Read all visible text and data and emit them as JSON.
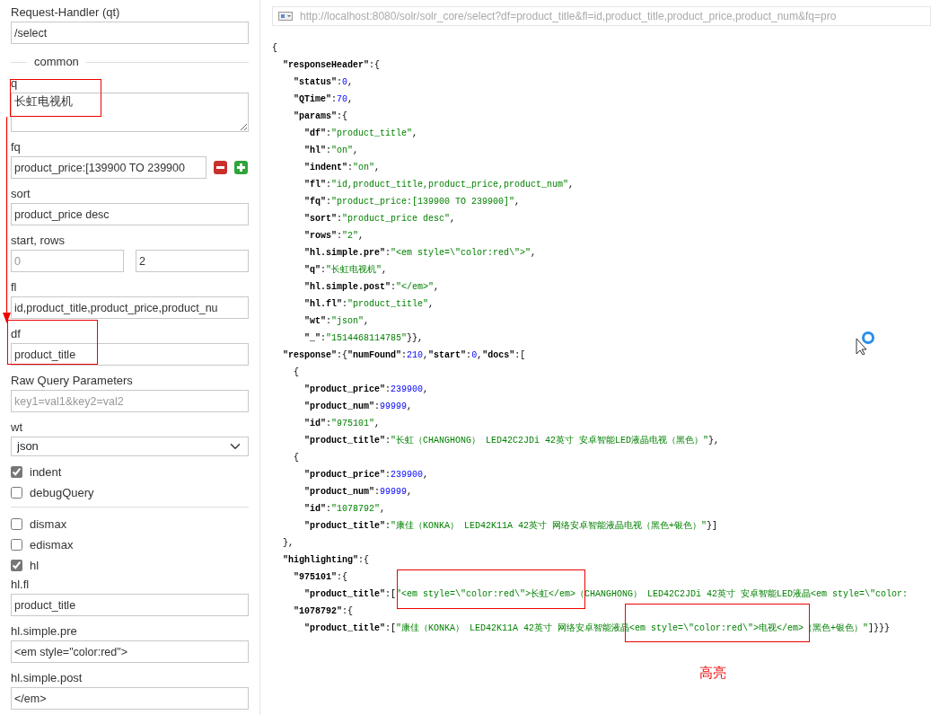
{
  "form": {
    "fields": [
      {
        "kind": "text",
        "label": "Request-Handler (qt)",
        "value": "/select"
      },
      {
        "kind": "legend",
        "label": "common"
      },
      {
        "kind": "textarea",
        "label": "q",
        "value": "长虹电视机"
      },
      {
        "kind": "filter",
        "label": "fq",
        "value": "product_price:[139900 TO 239900"
      },
      {
        "kind": "text",
        "label": "sort",
        "value": "product_price desc"
      },
      {
        "kind": "pair",
        "label": "start, rows",
        "inputs": [
          {
            "placeholder": "0"
          },
          {
            "value": "2"
          }
        ]
      },
      {
        "kind": "text",
        "label": "fl",
        "value": "id,product_title,product_price,product_nu"
      },
      {
        "kind": "text",
        "label": "df",
        "value": "product_title"
      },
      {
        "kind": "text",
        "label": "Raw Query Parameters",
        "placeholder": "key1=val1&key2=val2"
      },
      {
        "kind": "select",
        "label": "wt",
        "value": "json"
      },
      {
        "kind": "checkbox",
        "label": "indent",
        "checked": true
      },
      {
        "kind": "checkbox",
        "label": "debugQuery",
        "checked": false
      }
    ],
    "options": [
      {
        "kind": "checkbox",
        "label": "dismax",
        "checked": false
      },
      {
        "kind": "checkbox",
        "label": "edismax",
        "checked": false
      },
      {
        "kind": "checkbox",
        "label": "hl",
        "checked": true
      },
      {
        "kind": "text",
        "label": "hl.fl",
        "value": "product_title"
      },
      {
        "kind": "text",
        "label": "hl.simple.pre",
        "value": "<em style=\"color:red\">"
      },
      {
        "kind": "text",
        "label": "hl.simple.post",
        "value": "</em>"
      }
    ]
  },
  "result": {
    "url": "http://localhost:8080/solr/solr_core/select?df=product_title&fl=id,product_title,product_price,product_num&fq=pro",
    "lines": [
      {
        "tokens": [
          {
            "kind": "punct",
            "text": "{"
          }
        ],
        "children": [
          {
            "tokens": [
              {
                "kind": "key",
                "text": "\"responseHeader\""
              },
              {
                "kind": "punct",
                "text": ":{"
              }
            ],
            "children": [
              {
                "tokens": [
                  {
                    "kind": "key",
                    "text": "\"status\""
                  },
                  {
                    "kind": "punct",
                    "text": ":"
                  },
                  {
                    "kind": "number",
                    "text": "0"
                  },
                  {
                    "kind": "punct",
                    "text": ","
                  }
                ]
              },
              {
                "tokens": [
                  {
                    "kind": "key",
                    "text": "\"QTime\""
                  },
                  {
                    "kind": "punct",
                    "text": ":"
                  },
                  {
                    "kind": "number",
                    "text": "70"
                  },
                  {
                    "kind": "punct",
                    "text": ","
                  }
                ]
              },
              {
                "tokens": [
                  {
                    "kind": "key",
                    "text": "\"params\""
                  },
                  {
                    "kind": "punct",
                    "text": ":{"
                  }
                ],
                "children": [
                  {
                    "tokens": [
                      {
                        "kind": "key",
                        "text": "\"df\""
                      },
                      {
                        "kind": "punct",
                        "text": ":"
                      },
                      {
                        "kind": "string",
                        "text": "\"product_title\""
                      },
                      {
                        "kind": "punct",
                        "text": ","
                      }
                    ]
                  },
                  {
                    "tokens": [
                      {
                        "kind": "key",
                        "text": "\"hl\""
                      },
                      {
                        "kind": "punct",
                        "text": ":"
                      },
                      {
                        "kind": "string",
                        "text": "\"on\""
                      },
                      {
                        "kind": "punct",
                        "text": ","
                      }
                    ]
                  },
                  {
                    "tokens": [
                      {
                        "kind": "key",
                        "text": "\"indent\""
                      },
                      {
                        "kind": "punct",
                        "text": ":"
                      },
                      {
                        "kind": "string",
                        "text": "\"on\""
                      },
                      {
                        "kind": "punct",
                        "text": ","
                      }
                    ]
                  },
                  {
                    "tokens": [
                      {
                        "kind": "key",
                        "text": "\"fl\""
                      },
                      {
                        "kind": "punct",
                        "text": ":"
                      },
                      {
                        "kind": "string",
                        "text": "\"id,product_title,product_price,product_num\""
                      },
                      {
                        "kind": "punct",
                        "text": ","
                      }
                    ]
                  },
                  {
                    "tokens": [
                      {
                        "kind": "key",
                        "text": "\"fq\""
                      },
                      {
                        "kind": "punct",
                        "text": ":"
                      },
                      {
                        "kind": "string",
                        "text": "\"product_price:[139900 TO 239900]\""
                      },
                      {
                        "kind": "punct",
                        "text": ","
                      }
                    ]
                  },
                  {
                    "tokens": [
                      {
                        "kind": "key",
                        "text": "\"sort\""
                      },
                      {
                        "kind": "punct",
                        "text": ":"
                      },
                      {
                        "kind": "string",
                        "text": "\"product_price desc\""
                      },
                      {
                        "kind": "punct",
                        "text": ","
                      }
                    ]
                  },
                  {
                    "tokens": [
                      {
                        "kind": "key",
                        "text": "\"rows\""
                      },
                      {
                        "kind": "punct",
                        "text": ":"
                      },
                      {
                        "kind": "string",
                        "text": "\"2\""
                      },
                      {
                        "kind": "punct",
                        "text": ","
                      }
                    ]
                  },
                  {
                    "tokens": [
                      {
                        "kind": "key",
                        "text": "\"hl.simple.pre\""
                      },
                      {
                        "kind": "punct",
                        "text": ":"
                      },
                      {
                        "kind": "string",
                        "text": "\"<em style=\\\"color:red\\\">\""
                      },
                      {
                        "kind": "punct",
                        "text": ","
                      }
                    ]
                  },
                  {
                    "tokens": [
                      {
                        "kind": "key",
                        "text": "\"q\""
                      },
                      {
                        "kind": "punct",
                        "text": ":"
                      },
                      {
                        "kind": "string",
                        "text": "\"长虹电视机\""
                      },
                      {
                        "kind": "punct",
                        "text": ","
                      }
                    ]
                  },
                  {
                    "tokens": [
                      {
                        "kind": "key",
                        "text": "\"hl.simple.post\""
                      },
                      {
                        "kind": "punct",
                        "text": ":"
                      },
                      {
                        "kind": "string",
                        "text": "\"</em>\""
                      },
                      {
                        "kind": "punct",
                        "text": ","
                      }
                    ]
                  },
                  {
                    "tokens": [
                      {
                        "kind": "key",
                        "text": "\"hl.fl\""
                      },
                      {
                        "kind": "punct",
                        "text": ":"
                      },
                      {
                        "kind": "string",
                        "text": "\"product_title\""
                      },
                      {
                        "kind": "punct",
                        "text": ","
                      }
                    ]
                  },
                  {
                    "tokens": [
                      {
                        "kind": "key",
                        "text": "\"wt\""
                      },
                      {
                        "kind": "punct",
                        "text": ":"
                      },
                      {
                        "kind": "string",
                        "text": "\"json\""
                      },
                      {
                        "kind": "punct",
                        "text": ","
                      }
                    ]
                  },
                  {
                    "tokens": [
                      {
                        "kind": "key",
                        "text": "\"_\""
                      },
                      {
                        "kind": "punct",
                        "text": ":"
                      },
                      {
                        "kind": "string",
                        "text": "\"1514468114785\""
                      },
                      {
                        "kind": "punct",
                        "text": "}},"
                      }
                    ]
                  }
                ]
              }
            ]
          },
          {
            "tokens": [
              {
                "kind": "key",
                "text": "\"response\""
              },
              {
                "kind": "punct",
                "text": ":{"
              },
              {
                "kind": "key",
                "text": "\"numFound\""
              },
              {
                "kind": "punct",
                "text": ":"
              },
              {
                "kind": "number",
                "text": "210"
              },
              {
                "kind": "punct",
                "text": ","
              },
              {
                "kind": "key",
                "text": "\"start\""
              },
              {
                "kind": "punct",
                "text": ":"
              },
              {
                "kind": "number",
                "text": "0"
              },
              {
                "kind": "punct",
                "text": ","
              },
              {
                "kind": "key",
                "text": "\"docs\""
              },
              {
                "kind": "punct",
                "text": ":["
              }
            ],
            "children": [
              {
                "tokens": [
                  {
                    "kind": "punct",
                    "text": "{"
                  }
                ],
                "children": [
                  {
                    "tokens": [
                      {
                        "kind": "key",
                        "text": "\"product_price\""
                      },
                      {
                        "kind": "punct",
                        "text": ":"
                      },
                      {
                        "kind": "number",
                        "text": "239900"
                      },
                      {
                        "kind": "punct",
                        "text": ","
                      }
                    ]
                  },
                  {
                    "tokens": [
                      {
                        "kind": "key",
                        "text": "\"product_num\""
                      },
                      {
                        "kind": "punct",
                        "text": ":"
                      },
                      {
                        "kind": "number",
                        "text": "99999"
                      },
                      {
                        "kind": "punct",
                        "text": ","
                      }
                    ]
                  },
                  {
                    "tokens": [
                      {
                        "kind": "key",
                        "text": "\"id\""
                      },
                      {
                        "kind": "punct",
                        "text": ":"
                      },
                      {
                        "kind": "string",
                        "text": "\"975101\""
                      },
                      {
                        "kind": "punct",
                        "text": ","
                      }
                    ]
                  },
                  {
                    "tokens": [
                      {
                        "kind": "key",
                        "text": "\"product_title\""
                      },
                      {
                        "kind": "punct",
                        "text": ":"
                      },
                      {
                        "kind": "string",
                        "text": "\"长虹（CHANGHONG） LED42C2JDi 42英寸 安卓智能LED液晶电视（黑色）\""
                      },
                      {
                        "kind": "punct",
                        "text": "},"
                      }
                    ]
                  }
                ]
              },
              {
                "tokens": [
                  {
                    "kind": "punct",
                    "text": "{"
                  }
                ],
                "children": [
                  {
                    "tokens": [
                      {
                        "kind": "key",
                        "text": "\"product_price\""
                      },
                      {
                        "kind": "punct",
                        "text": ":"
                      },
                      {
                        "kind": "number",
                        "text": "239900"
                      },
                      {
                        "kind": "punct",
                        "text": ","
                      }
                    ]
                  },
                  {
                    "tokens": [
                      {
                        "kind": "key",
                        "text": "\"product_num\""
                      },
                      {
                        "kind": "punct",
                        "text": ":"
                      },
                      {
                        "kind": "number",
                        "text": "99999"
                      },
                      {
                        "kind": "punct",
                        "text": ","
                      }
                    ]
                  },
                  {
                    "tokens": [
                      {
                        "kind": "key",
                        "text": "\"id\""
                      },
                      {
                        "kind": "punct",
                        "text": ":"
                      },
                      {
                        "kind": "string",
                        "text": "\"1078792\""
                      },
                      {
                        "kind": "punct",
                        "text": ","
                      }
                    ]
                  },
                  {
                    "tokens": [
                      {
                        "kind": "key",
                        "text": "\"product_title\""
                      },
                      {
                        "kind": "punct",
                        "text": ":"
                      },
                      {
                        "kind": "string",
                        "text": "\"康佳（KONKA） LED42K11A 42英寸 网络安卓智能液晶电视（黑色+银色）\""
                      },
                      {
                        "kind": "punct",
                        "text": "}]"
                      }
                    ]
                  }
                ]
              }
            ]
          },
          {
            "tokens": [
              {
                "kind": "punct",
                "text": "},"
              }
            ]
          },
          {
            "tokens": [
              {
                "kind": "key",
                "text": "\"highlighting\""
              },
              {
                "kind": "punct",
                "text": ":{"
              }
            ],
            "children": [
              {
                "tokens": [
                  {
                    "kind": "key",
                    "text": "\"975101\""
                  },
                  {
                    "kind": "punct",
                    "text": ":{"
                  }
                ],
                "children": [
                  {
                    "tokens": [
                      {
                        "kind": "key",
                        "text": "\"product_title\""
                      },
                      {
                        "kind": "punct",
                        "text": ":["
                      },
                      {
                        "kind": "string",
                        "text": "\"<em style=\\\"color:red\\\">长虹</em>（CHANGHONG） LED42C2JDi 42英寸 安卓智能LED液晶<em style=\\\"color:"
                      }
                    ]
                  }
                ]
              },
              {
                "tokens": [
                  {
                    "kind": "key",
                    "text": "\"1078792\""
                  },
                  {
                    "kind": "punct",
                    "text": ":{"
                  }
                ],
                "children": [
                  {
                    "tokens": [
                      {
                        "kind": "key",
                        "text": "\"product_title\""
                      },
                      {
                        "kind": "punct",
                        "text": ":["
                      },
                      {
                        "kind": "string",
                        "text": "\"康佳（KONKA） LED42K11A 42英寸 网络安卓智能液晶<em style=\\\"color:red\\\">电视</em>（黑色+银色）\""
                      },
                      {
                        "kind": "punct",
                        "text": "]}}}"
                      }
                    ]
                  }
                ]
              }
            ]
          }
        ]
      }
    ]
  },
  "annotation": {
    "label": "高亮"
  }
}
